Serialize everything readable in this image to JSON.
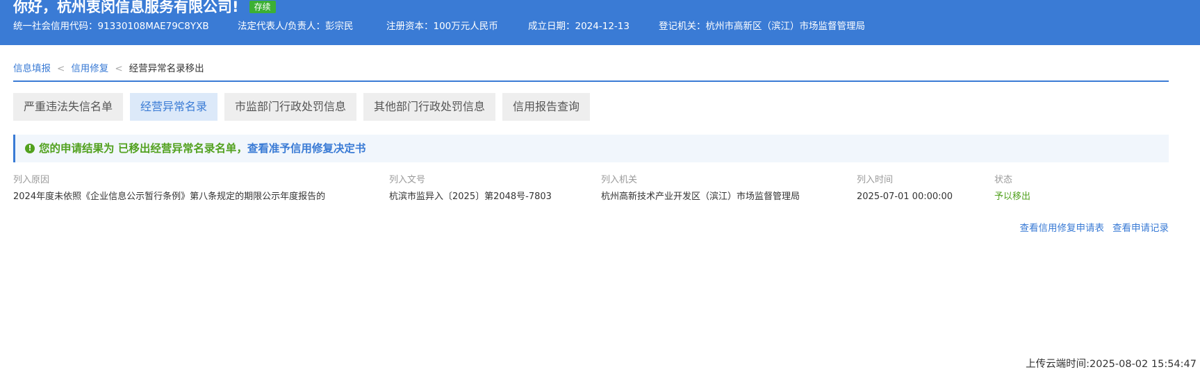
{
  "header": {
    "greeting": "你好，杭州衷闵信息服务有限公司!",
    "status_badge": "存续",
    "info": {
      "credit_code": "统一社会信用代码：91330108MAE79C8YXB",
      "legal_rep": "法定代表人/负责人：彭宗民",
      "capital": "注册资本：100万元人民币",
      "founded": "成立日期：2024-12-13",
      "authority": "登记机关：杭州市高新区（滨江）市场监督管理局"
    }
  },
  "breadcrumb": {
    "items": [
      "信息填报",
      "信用修复"
    ],
    "separator": "<",
    "current": "经营异常名录移出"
  },
  "tabs": [
    {
      "label": "严重违法失信名单",
      "active": false
    },
    {
      "label": "经营异常名录",
      "active": true
    },
    {
      "label": "市监部门行政处罚信息",
      "active": false
    },
    {
      "label": "其他部门行政处罚信息",
      "active": false
    },
    {
      "label": "信用报告查询",
      "active": false
    }
  ],
  "notice": {
    "icon": "!",
    "prefix": "您的申请结果为 已移出经营异常名录名单，",
    "link": "查看准予信用修复决定书"
  },
  "table": {
    "headers": {
      "reason": "列入原因",
      "doc_no": "列入文号",
      "authority": "列入机关",
      "time": "列入时间",
      "status": "状态"
    },
    "row": {
      "reason": "2024年度未依照《企业信息公示暂行条例》第八条规定的期限公示年度报告的",
      "doc_no": "杭滨市监异入〔2025〕第2048号-7803",
      "authority": "杭州高新技术产业开发区（滨江）市场监督管理局",
      "time": "2025-07-01 00:00:00",
      "status": "予以移出"
    }
  },
  "actions": {
    "view_application_form": "查看信用修复申请表",
    "view_application_record": "查看申请记录"
  },
  "footer": {
    "upload_time": "上传云端时间:2025-08-02 15:54:47"
  },
  "colors": {
    "header_bg": "#3a7bd5",
    "badge_bg": "#3cb034",
    "success_green": "#52a11f",
    "link_blue": "#3a7bd5"
  }
}
